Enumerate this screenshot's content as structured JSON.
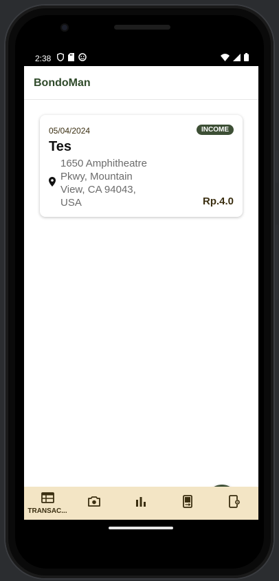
{
  "status_bar": {
    "time": "2:38",
    "left_icons": [
      "shield-icon",
      "sd-card-icon",
      "face-icon"
    ],
    "right_icons": [
      "wifi-icon",
      "signal-icon",
      "battery-icon"
    ]
  },
  "app_bar": {
    "title": "BondoMan"
  },
  "transactions": [
    {
      "date": "05/04/2024",
      "badge": "INCOME",
      "title": "Tes",
      "address_lines": [
        "1650 Amphitheatre",
        "Pkwy, Mountain",
        "View, CA 94043,",
        "USA"
      ],
      "amount": "Rp.4.0"
    }
  ],
  "fab": {
    "icon": "plus-icon"
  },
  "bottom_nav": {
    "items": [
      {
        "label": "TRANSAC...",
        "icon": "table-icon",
        "selected": true
      },
      {
        "label": "",
        "icon": "camera-icon",
        "selected": false
      },
      {
        "label": "",
        "icon": "bar-chart-icon",
        "selected": false
      },
      {
        "label": "",
        "icon": "phone-transfer-icon",
        "selected": false
      },
      {
        "label": "",
        "icon": "phone-settings-icon",
        "selected": false
      }
    ]
  },
  "colors": {
    "primary": "#3d4f35",
    "nav_background": "#f3e5c5",
    "text_brown": "#3a2e10",
    "title_green": "#2f4a2a"
  }
}
